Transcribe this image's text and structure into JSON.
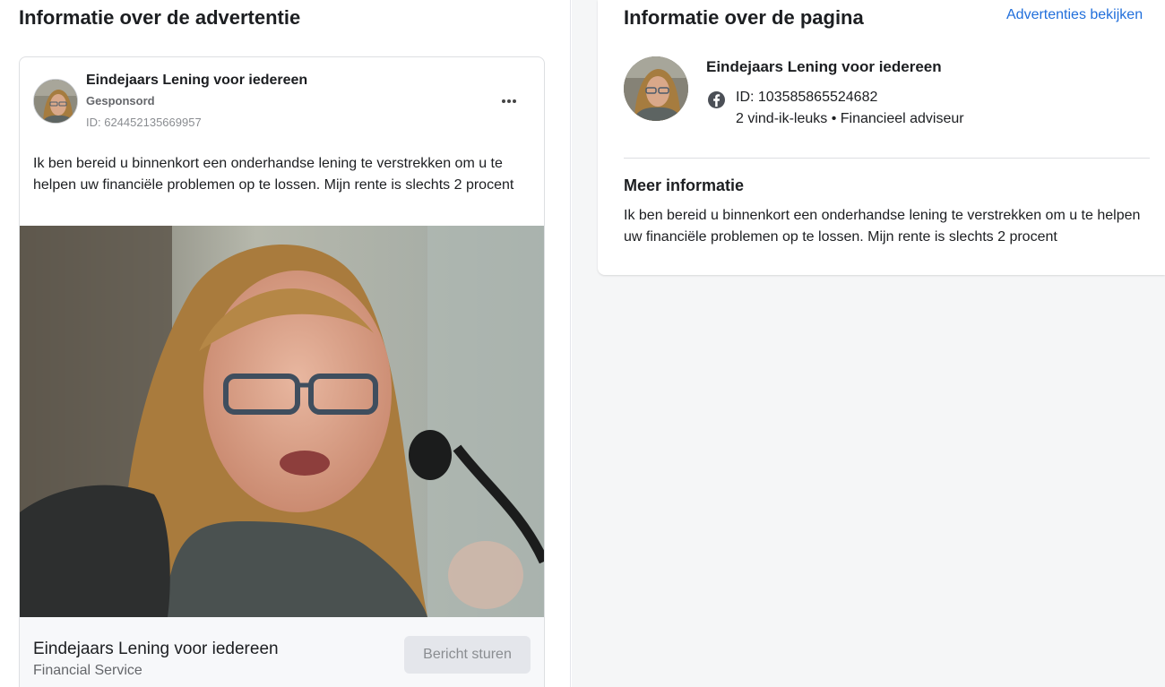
{
  "ad_info": {
    "section_title": "Informatie over de advertentie",
    "advertiser_name": "Eindejaars Lening voor iedereen",
    "sponsored_label": "Gesponsord",
    "ad_id": "ID: 624452135669957",
    "more_options_icon": "more-horizontal-icon",
    "body_text": "Ik ben bereid u binnenkort een onderhandse lening te verstrekken om u te helpen uw financiële problemen op te lossen. Mijn rente is slechts 2 procent",
    "footer_title": "Eindejaars Lening voor iedereen",
    "footer_subtitle": "Financial Service",
    "cta_label": "Bericht sturen"
  },
  "page_info": {
    "section_title": "Informatie over de pagina",
    "view_ads_link": "Advertenties bekijken",
    "page_name": "Eindejaars Lening voor iedereen",
    "platform_icon": "facebook-icon",
    "page_id": "ID: 103585865524682",
    "page_meta": "2 vind-ik-leuks • Financieel adviseur",
    "more_info_title": "Meer informatie",
    "more_info_body": "Ik ben bereid u binnenkort een onderhandse lening te verstrekken om u te helpen uw financiële problemen op te lossen. Mijn rente is slechts 2 procent"
  },
  "colors": {
    "link": "#216fdb",
    "right_background": "#f5f6f7",
    "button_disabled": "#e4e6eb"
  }
}
